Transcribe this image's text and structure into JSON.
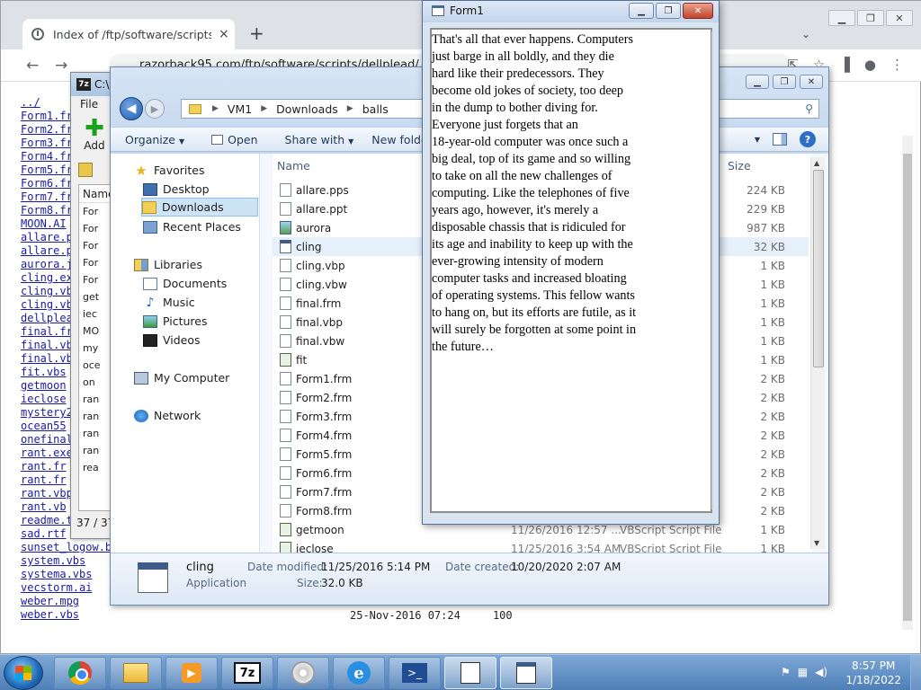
{
  "browser": {
    "tab_title": "Index of /ftp/software/scripts/del",
    "tab_close": "×",
    "new_tab": "+",
    "dropdown": "⌄",
    "url": "razorback95.com/ftp/software/scripts/dellplead/",
    "nav_back": "←",
    "nav_forward": "→",
    "listing": [
      "../",
      "Form1.fr",
      "Form2.fr",
      "Form3.fr",
      "Form4.fr",
      "Form5.fr",
      "Form6.fr",
      "Form7.fr",
      "Form8.fr",
      "MOON.AI",
      "allare.p",
      "allare.p",
      "aurora.j",
      "cling.ex",
      "cling.vb",
      "cling.vb",
      "dellplea",
      "final.fr",
      "final.vb",
      "final.vb",
      "fit.vbs",
      "getmoon",
      "ieclose",
      "mystery2",
      "ocean55",
      "onefinal",
      "rant.exe",
      "rant.fr",
      "rant.fr",
      "rant.vbp",
      "rant.vb",
      "readme.t",
      "sad.rtf",
      "sunset_logow.b",
      "system.vbs",
      "systema.vbs",
      "vecstorm.ai",
      "weber.mpg",
      "weber.vbs"
    ],
    "listing_footer": "25-Nov-2016 07:24     100"
  },
  "sevenzip": {
    "logo": "7z",
    "title": "C:\\",
    "menu_file": "File",
    "add_label": "Add",
    "name_header": "Name",
    "rows": [
      "For",
      "For",
      "For",
      "For",
      "For",
      "get",
      "iec",
      "MO",
      "my",
      "oce",
      "on",
      "ran",
      "ran",
      "ran",
      "ran",
      "rea"
    ],
    "status": "37 / 37"
  },
  "explorer": {
    "address": [
      "VM1",
      "Downloads",
      "balls"
    ],
    "toolbar": {
      "organize": "Organize",
      "open": "Open",
      "share_with": "Share with",
      "new_folder": "New folde"
    },
    "nav": {
      "favorites": "Favorites",
      "desktop": "Desktop",
      "downloads": "Downloads",
      "recent_places": "Recent Places",
      "libraries": "Libraries",
      "documents": "Documents",
      "music": "Music",
      "pictures": "Pictures",
      "videos": "Videos",
      "my_computer": "My Computer",
      "network": "Network"
    },
    "columns": {
      "name": "Name",
      "size": "Size"
    },
    "files": [
      {
        "name": "allare.pps",
        "size": "224 KB",
        "date": "",
        "type": ""
      },
      {
        "name": "allare.ppt",
        "size": "229 KB",
        "date": "",
        "type": ""
      },
      {
        "name": "aurora",
        "size": "987 KB",
        "date": "",
        "type": ""
      },
      {
        "name": "cling",
        "size": "32 KB",
        "date": "",
        "type": ""
      },
      {
        "name": "cling.vbp",
        "size": "1 KB",
        "date": "",
        "type": ""
      },
      {
        "name": "cling.vbw",
        "size": "1 KB",
        "date": "",
        "type": ""
      },
      {
        "name": "final.frm",
        "size": "1 KB",
        "date": "",
        "type": ""
      },
      {
        "name": "final.vbp",
        "size": "1 KB",
        "date": "",
        "type": ""
      },
      {
        "name": "final.vbw",
        "size": "1 KB",
        "date": "",
        "type": ""
      },
      {
        "name": "fit",
        "size": "1 KB",
        "date": "",
        "type": ""
      },
      {
        "name": "Form1.frm",
        "size": "2 KB",
        "date": "",
        "type": ""
      },
      {
        "name": "Form2.frm",
        "size": "2 KB",
        "date": "",
        "type": ""
      },
      {
        "name": "Form3.frm",
        "size": "2 KB",
        "date": "",
        "type": ""
      },
      {
        "name": "Form4.frm",
        "size": "2 KB",
        "date": "",
        "type": ""
      },
      {
        "name": "Form5.frm",
        "size": "2 KB",
        "date": "",
        "type": ""
      },
      {
        "name": "Form6.frm",
        "size": "2 KB",
        "date": "",
        "type": ""
      },
      {
        "name": "Form7.frm",
        "size": "2 KB",
        "date": "",
        "type": ""
      },
      {
        "name": "Form8.frm",
        "size": "2 KB",
        "date": "",
        "type": ""
      },
      {
        "name": "getmoon",
        "size": "1 KB",
        "date": "11/26/2016 12:57 ...",
        "type": "VBScript Script File"
      },
      {
        "name": "ieclose",
        "size": "1 KB",
        "date": "11/25/2016 3:54 AM",
        "type": "VBScript Script File"
      }
    ],
    "details": {
      "name": "cling",
      "type": "Application",
      "modified_label": "Date modified:",
      "modified_value": "11/25/2016 5:14 PM",
      "created_label": "Date created:",
      "created_value": "10/20/2020 2:07 AM",
      "size_label": "Size:",
      "size_value": "32.0 KB"
    }
  },
  "form1": {
    "title": "Form1",
    "lines": [
      "That's all that ever happens. Computers",
      "just barge in all boldly, and they die",
      "hard like their predecessors. They",
      "become old jokes of society, too deep",
      "in the dump to bother diving for.",
      "Everyone just forgets that an",
      "18-year-old computer was once such a",
      "big deal, top of its game and so willing",
      "to take on all the new challenges of",
      "computing. Like the telephones of five",
      "years ago, however, it's merely a",
      "disposable chassis that is ridiculed for",
      "its age and inability to keep up with the",
      "ever-growing intensity of modern",
      "computer tasks and increased bloating",
      "of operating systems. This fellow wants",
      "to hang on, but its efforts are futile, as it",
      "will surely be forgotten at some point in",
      "the future…"
    ]
  },
  "taskbar": {
    "seven_zip": "7z",
    "ie_letter": "e",
    "ps_glyph": ">_",
    "time": "8:57 PM",
    "date": "1/18/2022"
  }
}
